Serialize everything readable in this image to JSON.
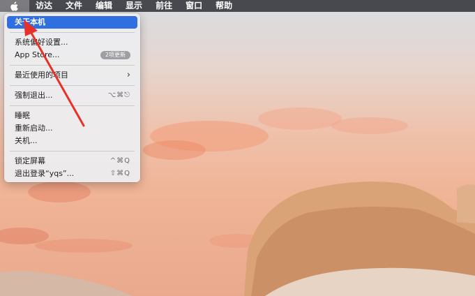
{
  "menubar": {
    "items": [
      "访达",
      "文件",
      "编辑",
      "显示",
      "前往",
      "窗口",
      "帮助"
    ]
  },
  "apple_menu": {
    "about": "关于本机",
    "system_prefs": "系统偏好设置...",
    "app_store": "App Store...",
    "app_store_badge": "2项更新",
    "recent_items": "最近使用的项目",
    "force_quit": "强制退出...",
    "force_quit_shortcut": "⌥⌘⎋",
    "sleep": "睡眠",
    "restart": "重新启动...",
    "shutdown": "关机...",
    "lock_screen": "锁定屏幕",
    "lock_screen_shortcut": "^⌘Q",
    "logout": "退出登录“yqs”...",
    "logout_shortcut": "⇧⌘Q"
  },
  "colors": {
    "selection": "#2f6fe0",
    "annotation_arrow": "#e8302a",
    "menubar": "#3c3c42"
  },
  "icons": {
    "apple": "apple-logo-icon",
    "submenu": "chevron-right-icon"
  }
}
